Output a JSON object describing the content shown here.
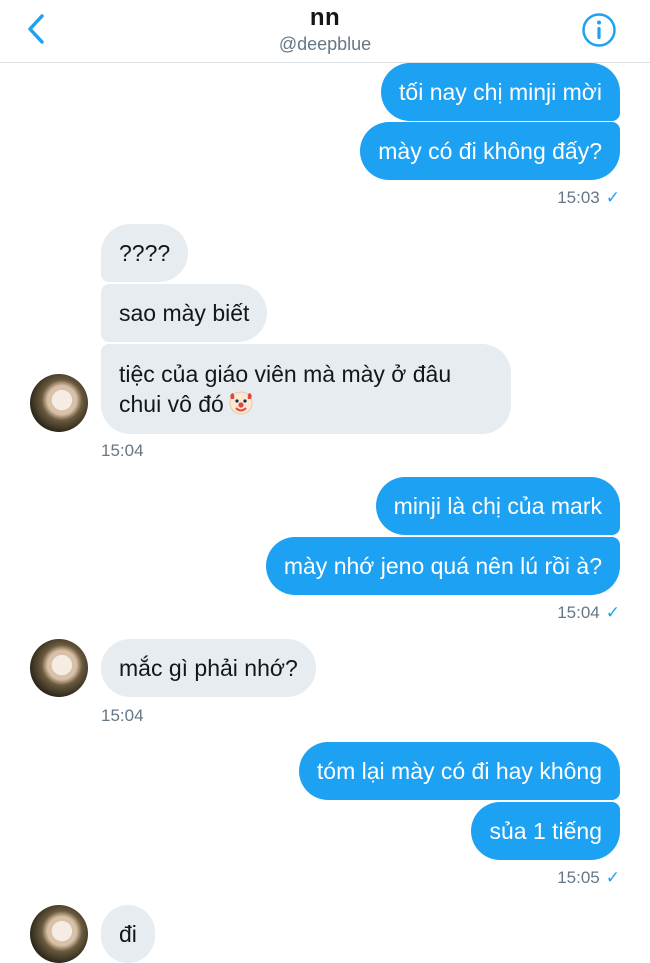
{
  "header": {
    "title": "nn",
    "handle": "@deepblue"
  },
  "messages": {
    "m1": "tối nay chị minji mời",
    "m2": "mày có đi không đấy?",
    "t1": "15:03",
    "m3": "????",
    "m4": "sao mày biết",
    "m5a": "tiệc của giáo viên mà mày ở đâu",
    "m5b": "chui vô đó",
    "t2": "15:04",
    "m6": "minji là chị của mark",
    "m7": "mày nhớ jeno quá nên lú rồi à?",
    "t3": "15:04",
    "m8": "mắc gì phải nhớ?",
    "t4": "15:04",
    "m9": "tóm lại mày có đi hay không",
    "m10": "sủa 1 tiếng",
    "t5": "15:05",
    "m11": "đi"
  },
  "icons": {
    "back": "chevron-left-icon",
    "info": "info-icon",
    "read": "check-icon",
    "emoji": "clown-face-emoji"
  },
  "colors": {
    "accent": "#1da1f2",
    "incoming_bubble": "#e6ecf0",
    "timestamp": "#657786"
  }
}
